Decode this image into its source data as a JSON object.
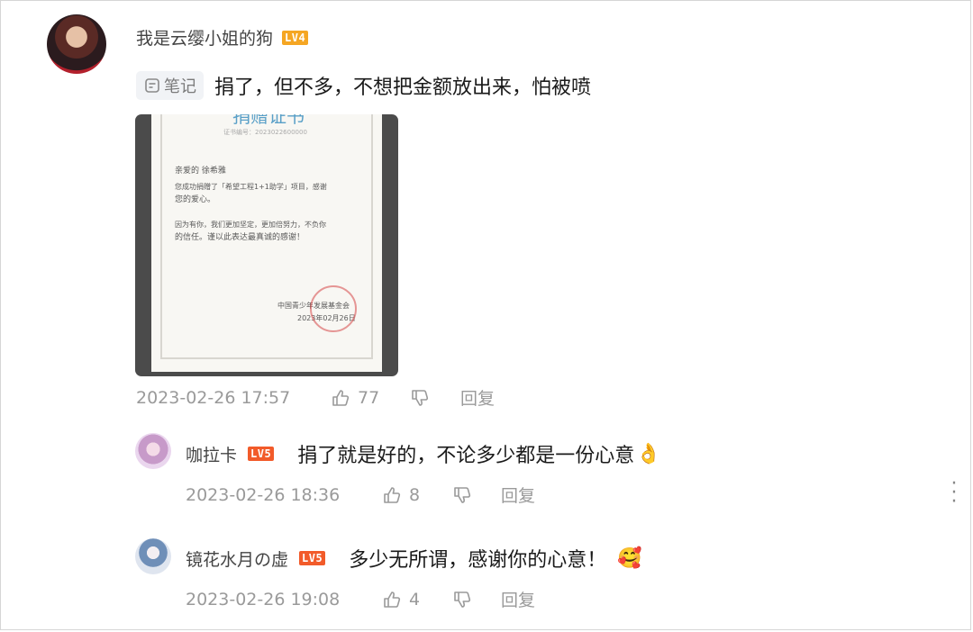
{
  "comment": {
    "username": "我是云缨小姐的狗",
    "level": "LV4",
    "tag_label": "笔记",
    "text": "捐了，但不多，不想把金额放出来，怕被喷",
    "certificate": {
      "title": "捐赠证书",
      "number_line": "证书编号：2023022600000",
      "line1": "亲爱的 徐希雅",
      "line2": "您成功捐赠了「希望工程1+1助学」项目，感谢",
      "line3": "您的爱心。",
      "line4": "因为有你，我们更加坚定，更加倍努力，不负你",
      "line5": "的信任。谨以此表达最真诚的感谢！",
      "org": "中国青少年发展基金会",
      "date": "2023年02月26日"
    },
    "timestamp": "2023-02-26 17:57",
    "likes": "77",
    "reply_label": "回复"
  },
  "replies": [
    {
      "username": "咖拉卡",
      "level": "LV5",
      "text": "捐了就是好的，不论多少都是一份心意",
      "emoji": "👌",
      "timestamp": "2023-02-26 18:36",
      "likes": "8",
      "reply_label": "回复"
    },
    {
      "username": "镜花水月の虚",
      "level": "LV5",
      "text": "多少无所谓，感谢你的心意！",
      "emoji": "🥰",
      "timestamp": "2023-02-26 19:08",
      "likes": "4",
      "reply_label": "回复"
    }
  ],
  "icons": {
    "like": "thumb-up-icon",
    "dislike": "thumb-down-icon",
    "more": "more-vertical-icon",
    "note": "note-icon"
  },
  "colors": {
    "level_lv4": "#f5a623",
    "level_lv5": "#f25b2a",
    "meta_text": "#9a9a9a"
  }
}
